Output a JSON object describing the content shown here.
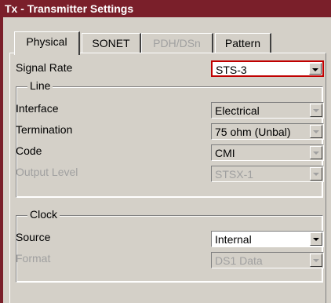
{
  "window": {
    "title": "Tx - Transmitter Settings"
  },
  "tabs": [
    {
      "label": "Physical",
      "state": "active"
    },
    {
      "label": "SONET",
      "state": "normal"
    },
    {
      "label": "PDH/DSn",
      "state": "disabled"
    },
    {
      "label": "Pattern",
      "state": "normal"
    }
  ],
  "signal_rate": {
    "label": "Signal Rate",
    "value": "STS-3"
  },
  "line": {
    "legend": "Line",
    "fields": [
      {
        "label": "Interface",
        "value": "Electrical",
        "enabled": true
      },
      {
        "label": "Termination",
        "value": "75 ohm (Unbal)",
        "enabled": true
      },
      {
        "label": "Code",
        "value": "CMI",
        "enabled": true
      },
      {
        "label": "Output Level",
        "value": "STSX-1",
        "enabled": false
      }
    ]
  },
  "clock": {
    "legend": "Clock",
    "fields": [
      {
        "label": "Source",
        "value": "Internal",
        "enabled": true
      },
      {
        "label": "Format",
        "value": "DS1 Data",
        "enabled": false
      }
    ]
  },
  "colors": {
    "titlebar": "#7a1f2a",
    "highlight_border": "#c00000",
    "face": "#d4d0c8"
  }
}
